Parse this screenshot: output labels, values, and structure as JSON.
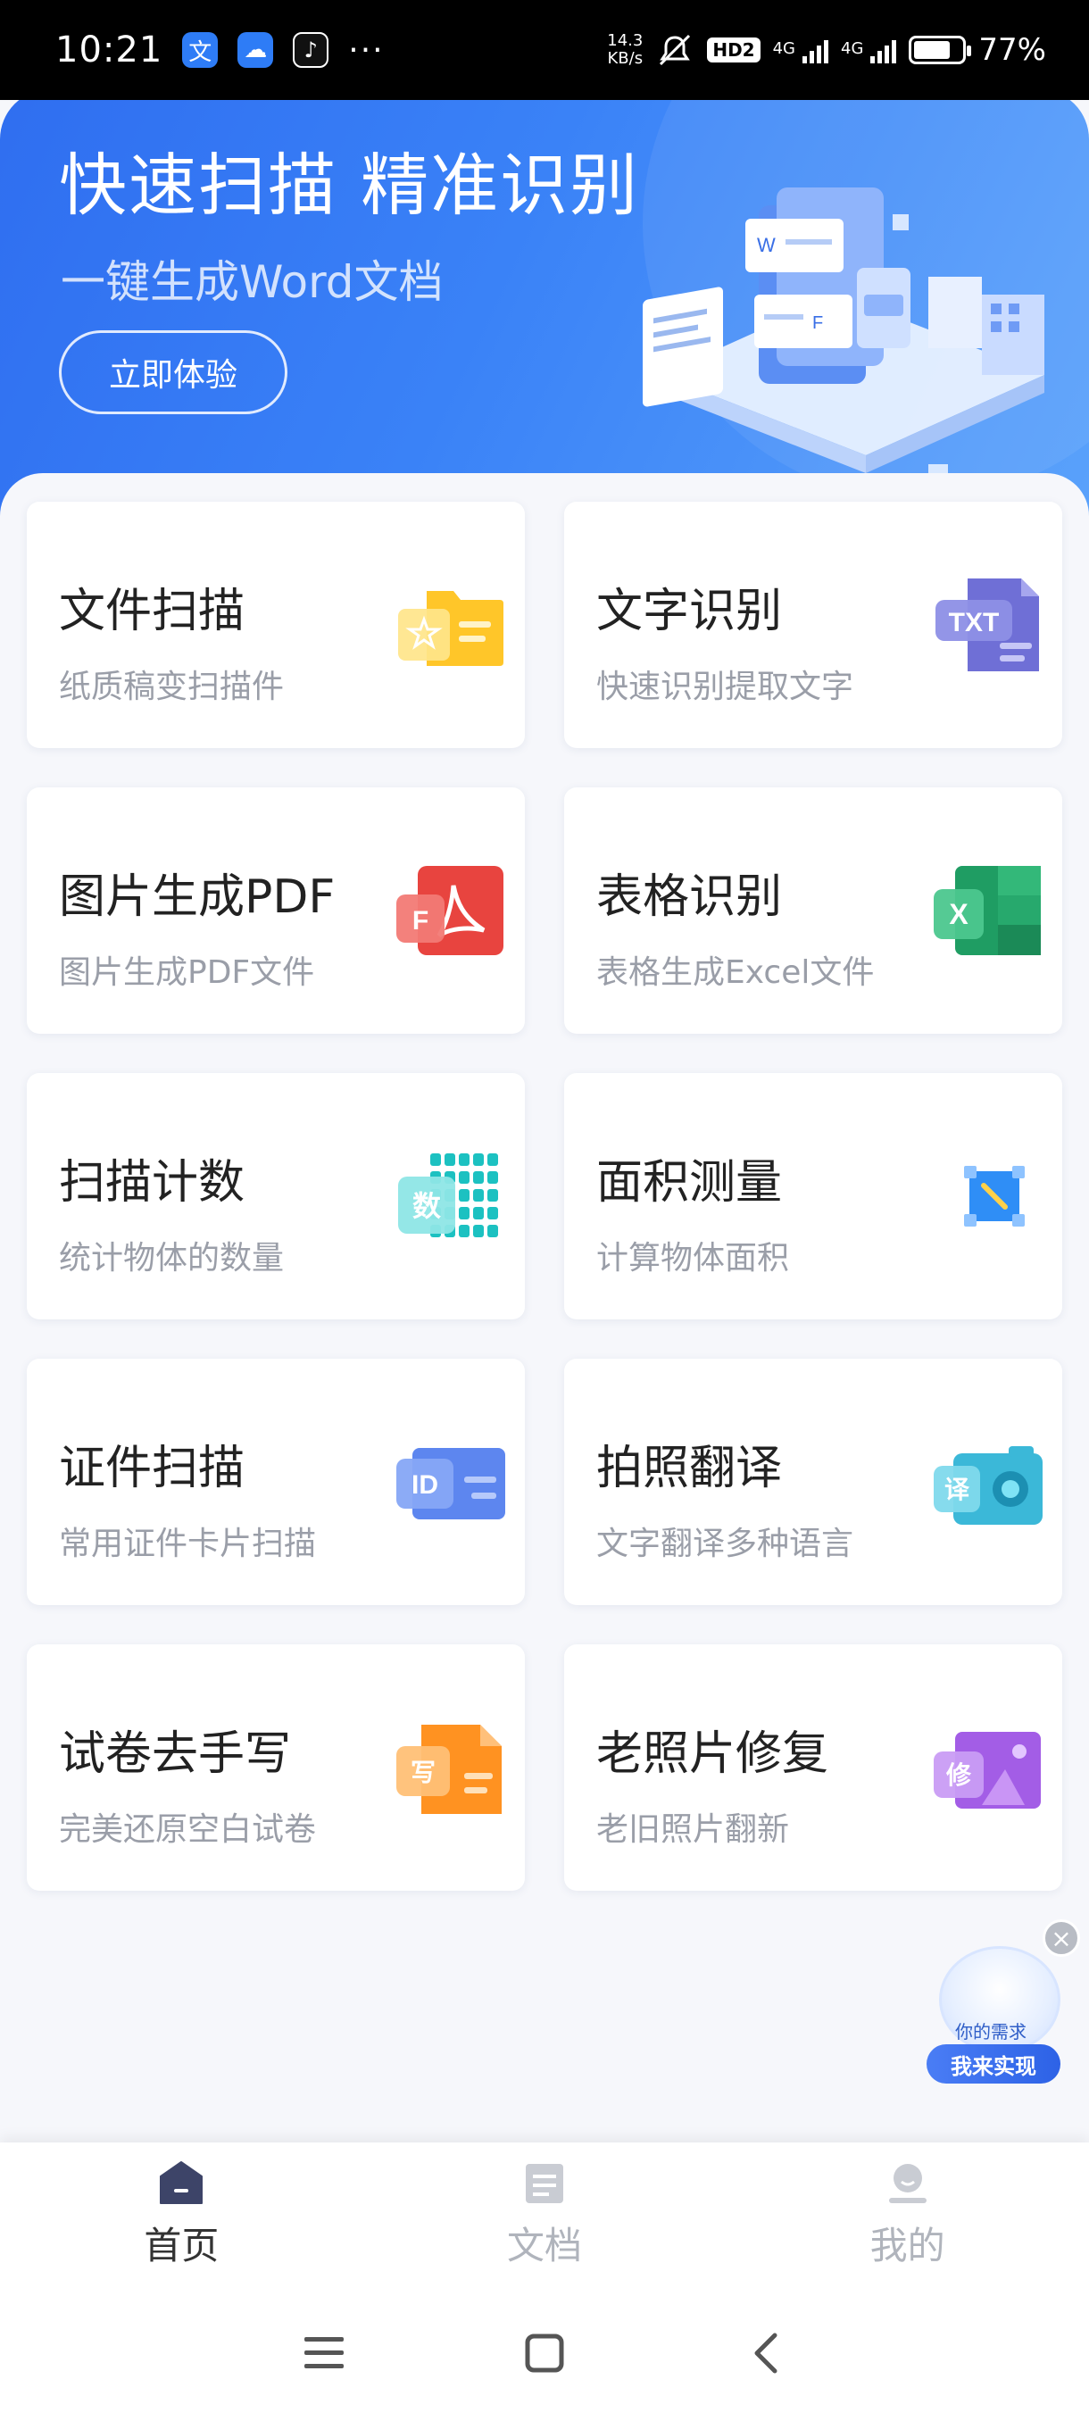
{
  "status_bar": {
    "time": "10:21",
    "speed_value": "14.3",
    "speed_unit": "KB/s",
    "hd_label": "HD2",
    "net1": "4G",
    "net2": "4G",
    "battery_percent": "77%",
    "battery_level": 0.77
  },
  "hero": {
    "title": "快速扫描 精准识别",
    "subtitle": "一键生成Word文档",
    "button_label": "立即体验"
  },
  "tools": [
    {
      "title": "文件扫描",
      "desc": "纸质稿变扫描件",
      "icon": "folder-star-icon"
    },
    {
      "title": "文字识别",
      "desc": "快速识别提取文字",
      "icon": "txt-file-icon",
      "icon_text": "TXT"
    },
    {
      "title": "图片生成PDF",
      "desc": "图片生成PDF文件",
      "icon": "pdf-icon",
      "icon_text": "F"
    },
    {
      "title": "表格识别",
      "desc": "表格生成Excel文件",
      "icon": "excel-icon",
      "icon_text": "X"
    },
    {
      "title": "扫描计数",
      "desc": "统计物体的数量",
      "icon": "count-grid-icon",
      "icon_text": "数"
    },
    {
      "title": "面积测量",
      "desc": "计算物体面积",
      "icon": "area-measure-icon"
    },
    {
      "title": "证件扫描",
      "desc": "常用证件卡片扫描",
      "icon": "id-card-icon",
      "icon_text": "ID"
    },
    {
      "title": "拍照翻译",
      "desc": "文字翻译多种语言",
      "icon": "camera-translate-icon",
      "icon_text": "译"
    },
    {
      "title": "试卷去手写",
      "desc": "完美还原空白试卷",
      "icon": "exam-erase-icon",
      "icon_text": "写"
    },
    {
      "title": "老照片修复",
      "desc": "老旧照片翻新",
      "icon": "photo-repair-icon",
      "icon_text": "修"
    }
  ],
  "float_widget": {
    "paper_text": "你的需求",
    "button_label": "我来实现"
  },
  "bottom_nav": [
    {
      "label": "首页",
      "icon": "home-icon",
      "active": true
    },
    {
      "label": "文档",
      "icon": "document-icon",
      "active": false
    },
    {
      "label": "我的",
      "icon": "profile-icon",
      "active": false
    }
  ],
  "colors": {
    "hero_start": "#2f6ef0",
    "hero_end": "#5aa2fb",
    "nav_active": "#333333",
    "nav_inactive": "#b0b4bc"
  }
}
